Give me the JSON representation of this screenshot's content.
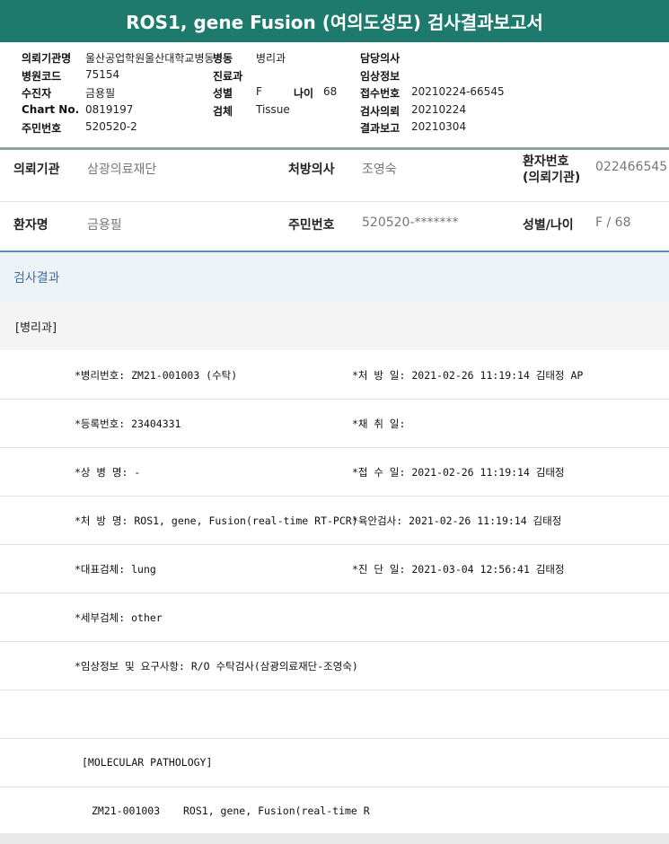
{
  "report": {
    "title": "ROS1, gene Fusion (여의도성모) 검사결과보고서"
  },
  "header": {
    "requesting_org_label": "의뢰기관명",
    "requesting_org": "울산공업학원울산대학교병동",
    "ward_label": "병동",
    "ward": "병리과",
    "doctor_label": "담당의사",
    "doctor": "",
    "hospital_code_label": "병원코드",
    "hospital_code": "75154",
    "dept_label": "진료과",
    "dept": "",
    "clinical_label": "임상정보",
    "clinical": "",
    "patient_label": "수진자",
    "patient": "금용필",
    "sex_label": "성별",
    "sex": "F",
    "age_label": "나이",
    "age": "68",
    "receipt_no_label": "접수번호",
    "receipt_no": "20210224-66545",
    "chart_no_label": "Chart No.",
    "chart_no": "0819197",
    "specimen_label": "검체",
    "specimen": "Tissue",
    "test_request_label": "검사의뢰",
    "test_request": "20210224",
    "resident_no_label": "주민번호",
    "resident_no": "520520-2",
    "result_report_label": "결과보고",
    "result_report": "20210304"
  },
  "info": {
    "org_label": "의뢰기관",
    "org": "삼광의료재단",
    "prescriber_label": "처방의사",
    "prescriber": "조영숙",
    "patient_no_label_1": "환자번호",
    "patient_no_label_2": "(의뢰기관)",
    "patient_no": "022466545",
    "patient_name_label": "환자명",
    "patient_name": "금용필",
    "resident_label": "주민번호",
    "resident": "520520-*******",
    "sexage_label": "성별/나이",
    "sexage": "F / 68"
  },
  "section": {
    "title": "검사결과",
    "dept": "[병리과]"
  },
  "results": {
    "path_no": "*병리번호: ZM21-001003 (수탁)",
    "rx_date": "*처 방 일: 2021-02-26 11:19:14  김태정 AP",
    "reg_no": "*등록번호: 23404331",
    "collect_date": "*채 취 일:",
    "disease": "*상 병 명: -",
    "receipt_date": "*접 수 일: 2021-02-26 11:19:14  김태정",
    "rx_name": "*처 방 명: ROS1, gene, Fusion(real-time RT-PCR)",
    "gross_exam": "*육안검사: 2021-02-26 11:19:14  김태정",
    "rep_specimen": "*대표검체: lung",
    "diag_date": "*진 단 일: 2021-03-04 12:56:41  김태정",
    "detail_specimen": "*세부검체: other",
    "clinical_req": "*임상정보 및 요구사항: R/O 수탁검사(삼광의료재단-조영숙)",
    "mol_header": "[MOLECULAR PATHOLOGY]",
    "mol_no": "ZM21-001003",
    "mol_test": "ROS1, gene, Fusion(real-time R"
  }
}
